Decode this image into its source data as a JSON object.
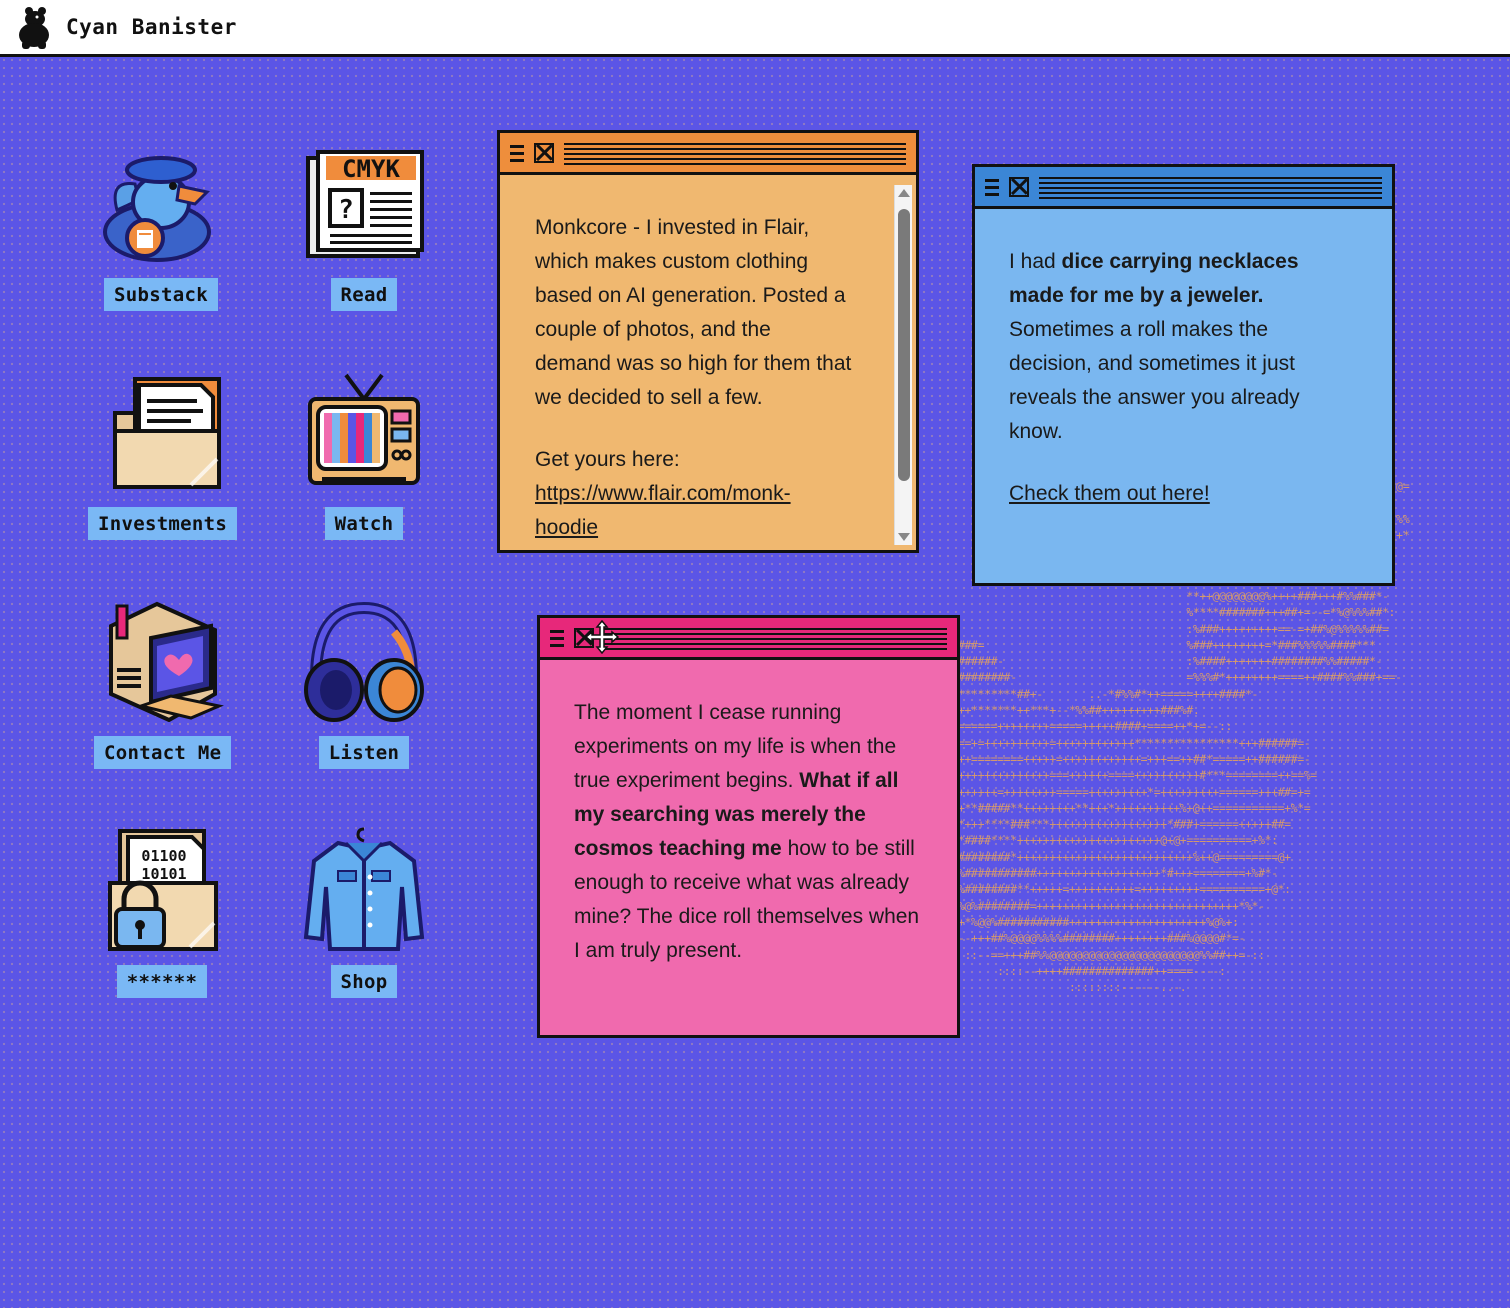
{
  "header": {
    "brand": "Cyan Banister"
  },
  "icons": {
    "substack": "Substack",
    "read": "Read",
    "investments": "Investments",
    "watch": "Watch",
    "contact": "Contact Me",
    "listen": "Listen",
    "password": "******",
    "shop": "Shop",
    "newspaper_title": "CMYK",
    "binary": [
      "01100",
      "10101"
    ]
  },
  "windows": {
    "orange": {
      "text": "Monkcore - I invested in Flair, which makes custom clothing based on AI generation. Posted a couple of photos, and the demand was so high for them that we decided to sell a few.",
      "get_yours": "Get yours here:",
      "link": "https://www.flair.com/monk-hoodie"
    },
    "blue": {
      "t1": "I had ",
      "bold": "dice carrying necklaces made for me by a jeweler.",
      "t2": " Sometimes a roll makes the decision, and sometimes it just reveals the answer you already know.",
      "link": "Check them out here!"
    },
    "pink": {
      "t1": "The moment I cease running experiments on my life is when the true experiment begins. ",
      "bold": "What if all my searching was merely the cosmos teaching me",
      "t2": " how to be still enough to receive what was already mine? The dice roll themselves when I am truly present."
    }
  },
  "colors": {
    "background": "#5b55e6",
    "orange_window": "#f0b870",
    "blue_window": "#7ab7f0",
    "pink_window": "#f06aae",
    "label_bg": "#7ab8f5"
  }
}
